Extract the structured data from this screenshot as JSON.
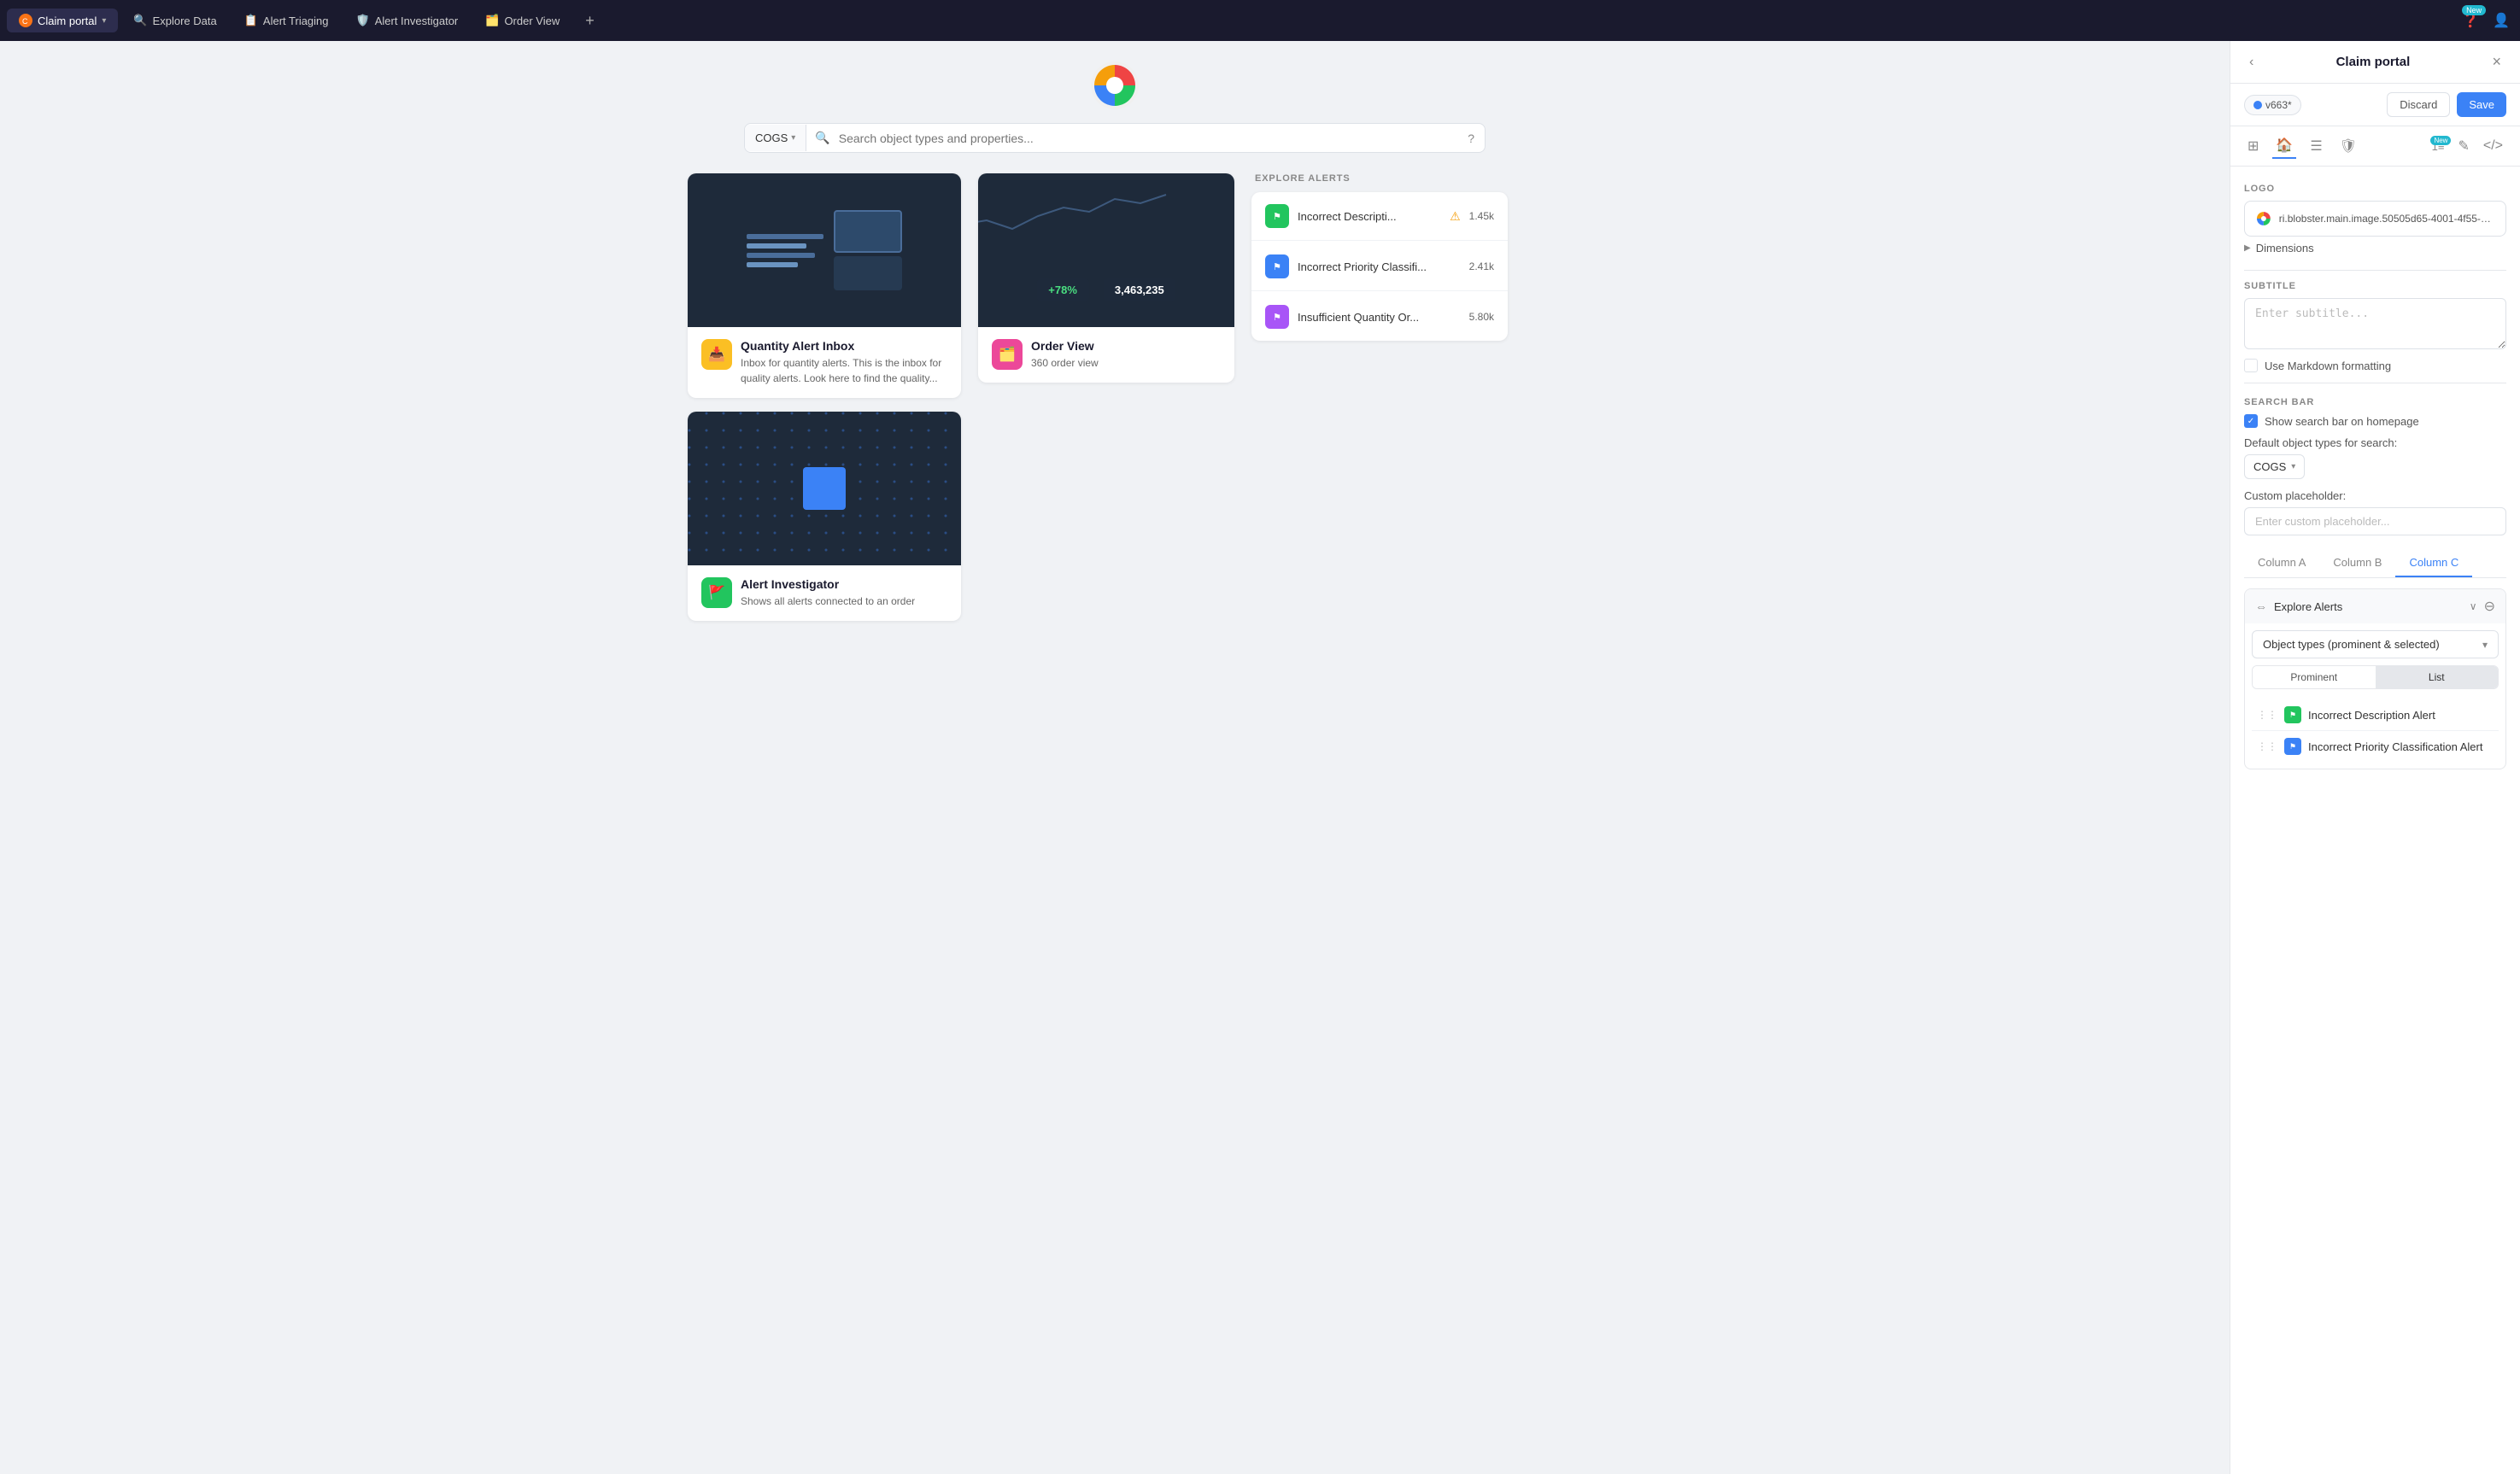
{
  "app": {
    "title": "Claim portal"
  },
  "topNav": {
    "tabs": [
      {
        "id": "claim-portal",
        "label": "Claim portal",
        "active": true,
        "iconColor": "#f97316"
      },
      {
        "id": "explore-data",
        "label": "Explore Data",
        "active": false,
        "iconColor": "#888"
      },
      {
        "id": "alert-triaging",
        "label": "Alert Triaging",
        "active": false,
        "iconColor": "#f59e0b"
      },
      {
        "id": "alert-investigator",
        "label": "Alert Investigator",
        "active": false,
        "iconColor": "#22c55e"
      },
      {
        "id": "order-view",
        "label": "Order View",
        "active": false,
        "iconColor": "#ec4899"
      }
    ],
    "newBadge": "New",
    "plusLabel": "+"
  },
  "searchBar": {
    "cogsLabel": "COGS",
    "placeholder": "Search object types and properties...",
    "helpIcon": "?"
  },
  "cards": {
    "quantityAlert": {
      "title": "Quantity Alert Inbox",
      "description": "Inbox for quantity alerts. This is the inbox for quality alerts. Look here to find the quality..."
    },
    "orderView": {
      "title": "Order View",
      "description": "360 order view",
      "statGrowth": "+78%",
      "statNumber": "3,463,235"
    },
    "alertInvestigator": {
      "title": "Alert Investigator",
      "description": "Shows all alerts connected to an order"
    }
  },
  "exploreAlerts": {
    "header": "EXPLORE ALERTS",
    "items": [
      {
        "name": "Incorrect Descripti...",
        "hasWarning": true,
        "count": "1.45k",
        "flagColor": "green"
      },
      {
        "name": "Incorrect Priority Classifi...",
        "hasWarning": false,
        "count": "2.41k",
        "flagColor": "blue"
      },
      {
        "name": "Insufficient Quantity Or...",
        "hasWarning": false,
        "count": "5.80k",
        "flagColor": "purple"
      }
    ]
  },
  "rightPanel": {
    "title": "Claim portal",
    "backIcon": "‹",
    "closeIcon": "×",
    "version": "v663*",
    "discardLabel": "Discard",
    "saveLabel": "Save",
    "logoSection": {
      "label": "LOGO",
      "logoPath": "ri.blobster.main.image.50505d65-4001-4f55-8f..."
    },
    "dimensionsLabel": "Dimensions",
    "subtitleSection": {
      "label": "SUBTITLE",
      "placeholder": "Enter subtitle...",
      "markdownLabel": "Use Markdown formatting"
    },
    "searchBarSection": {
      "label": "SEARCH BAR",
      "showSearchLabel": "Show search bar on homepage",
      "defaultObjectLabel": "Default object types for search:",
      "cogsLabel": "COGS",
      "customPlaceholderLabel": "Custom placeholder:",
      "customPlaceholderInput": "Enter custom placeholder..."
    },
    "columns": {
      "tabs": [
        "Column A",
        "Column B",
        "Column C"
      ],
      "activeTab": "Column C"
    },
    "exploreSection": {
      "title": "Explore Alerts",
      "objectTypeLabel": "Object types (prominent & selected)",
      "prominentTab": "Prominent",
      "listTab": "List",
      "listItems": [
        {
          "name": "Incorrect Description Alert",
          "flagColor": "green"
        },
        {
          "name": "Incorrect Priority Classification Alert",
          "flagColor": "blue"
        }
      ]
    }
  }
}
